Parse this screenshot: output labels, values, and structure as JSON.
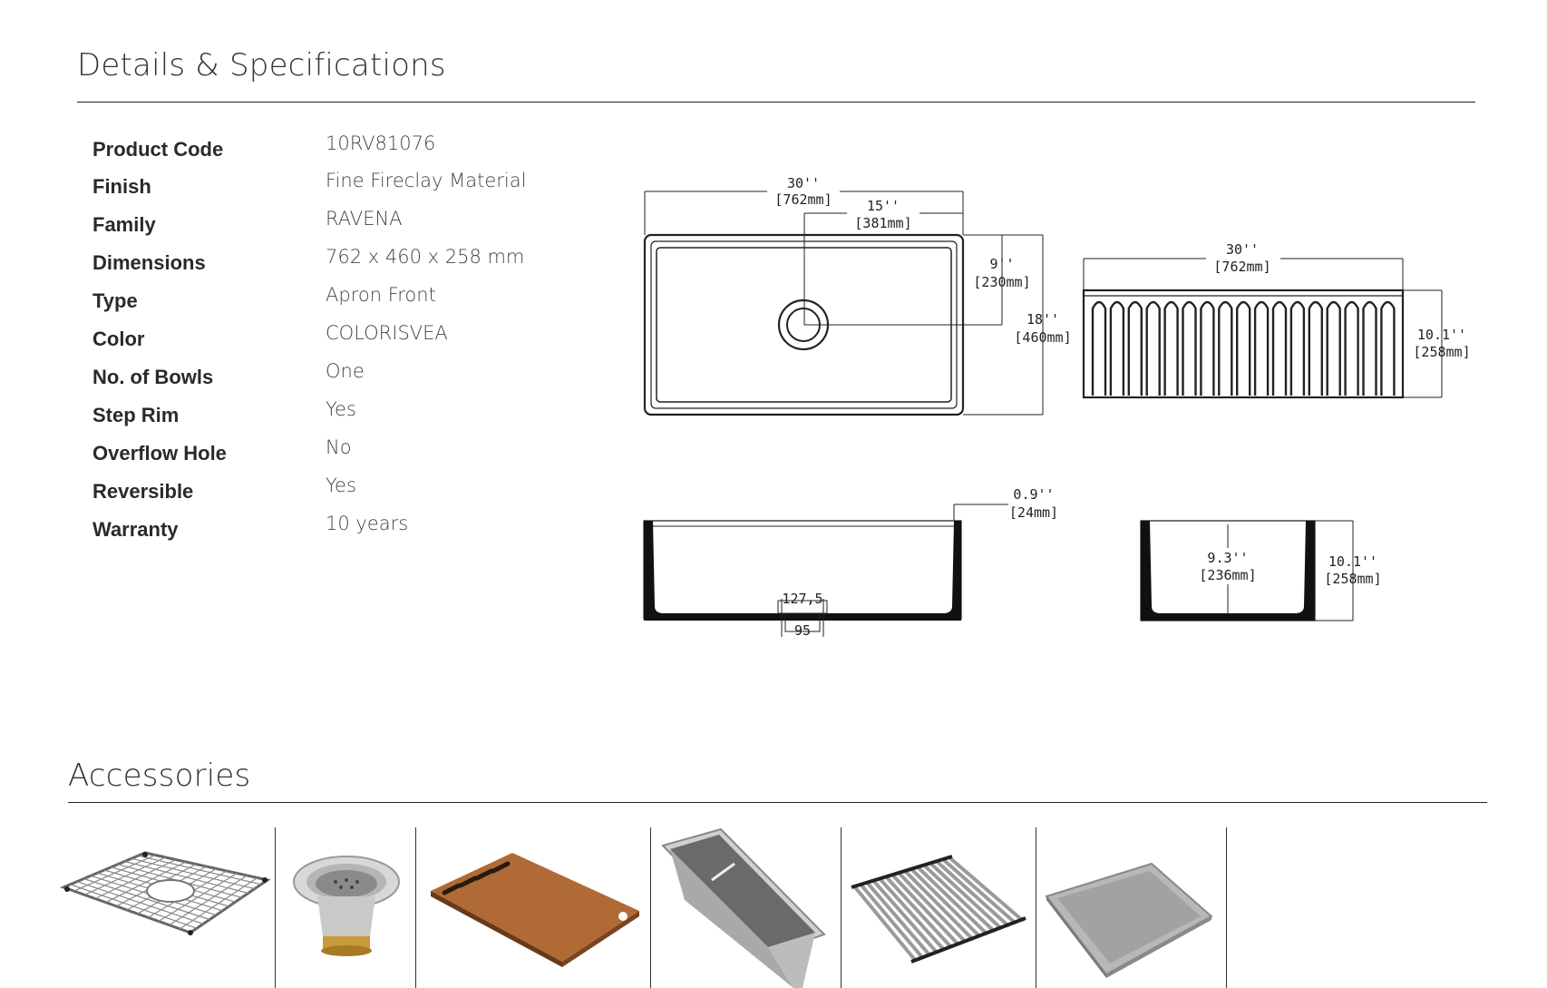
{
  "specs_section": {
    "title": "Details & Specifications",
    "rows": [
      {
        "label": "Product Code",
        "value": "10RV81076"
      },
      {
        "label": "Finish",
        "value": "Fine Fireclay Material"
      },
      {
        "label": "Family",
        "value": "RAVENA"
      },
      {
        "label": "Dimensions",
        "value": "762 x 460 x 258 mm"
      },
      {
        "label": "Type",
        "value": "Apron Front"
      },
      {
        "label": "Color",
        "value": "COLORISVEA"
      },
      {
        "label": "No. of Bowls",
        "value": "One"
      },
      {
        "label": "Step Rim",
        "value": "Yes"
      },
      {
        "label": "Overflow Hole",
        "value": "No"
      },
      {
        "label": "Reversible",
        "value": "Yes"
      },
      {
        "label": "Warranty",
        "value": "10 years"
      }
    ]
  },
  "drawings": {
    "top_view": {
      "width_in": "30''",
      "width_mm": "[762mm]",
      "center_in": "15''",
      "center_mm": "[381mm]",
      "drain_depth_in": "9''",
      "drain_depth_mm": "[230mm]",
      "depth_in": "18''",
      "depth_mm": "[460mm]"
    },
    "front_view": {
      "width_in": "30''",
      "width_mm": "[762mm]",
      "height_in": "10.1''",
      "height_mm": "[258mm]"
    },
    "side_section": {
      "rim_in": "0.9''",
      "rim_mm": "[24mm]",
      "drain_outer": "127,5",
      "drain_inner": "95"
    },
    "end_section": {
      "inner_in": "9.3''",
      "inner_mm": "[236mm]",
      "height_in": "10.1''",
      "height_mm": "[258mm]"
    }
  },
  "accessories_section": {
    "title": "Accessories",
    "items": [
      {
        "icon": "bottom-grid-icon"
      },
      {
        "icon": "basket-strainer-icon"
      },
      {
        "icon": "cutting-board-icon"
      },
      {
        "icon": "colander-icon"
      },
      {
        "icon": "roll-up-rack-icon"
      },
      {
        "icon": "drain-tray-icon"
      }
    ]
  },
  "colors": {
    "line": "#222222",
    "wood": "#b06a35",
    "steel": "#9a9a9a",
    "brass": "#c99a3a"
  }
}
